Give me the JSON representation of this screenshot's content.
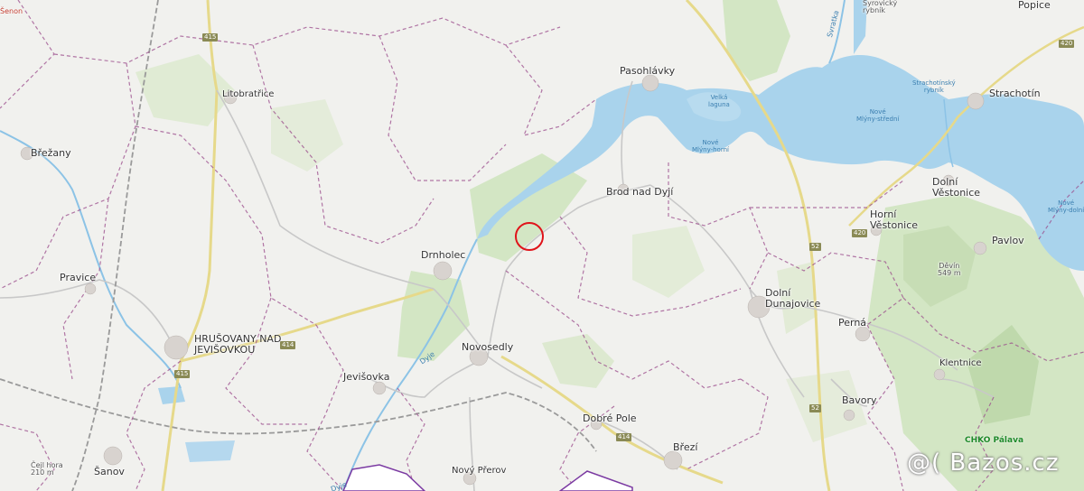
{
  "map": {
    "places": {
      "pasohlavky": "Pasohlávky",
      "strachotin": "Strachotín",
      "popice": "Popice",
      "brod": "Brod nad Dyjí",
      "dolni_vestonice": "Dolní\nVěstonice",
      "horni_vestonice": "Horní\nVěstonice",
      "pavlov": "Pavlov",
      "drnholec": "Drnholec",
      "litobratrice": "Litobratřice",
      "brezany": "Břežany",
      "pravice": "Pravice",
      "hrusovany": "HRUŠOVANY NAD\nJEVIŠOVKOU",
      "jevisovka": "Jevišovka",
      "novosedly": "Novosedly",
      "dolni_dunajovice": "Dolní\nDunajovice",
      "perna": "Perná",
      "klentnice": "Klentnice",
      "bavory": "Bavory",
      "dobre_pole": "Dobré Pole",
      "brezi": "Březí",
      "novy_prerov": "Nový Přerov",
      "sanov": "Šanov",
      "senon": "Šenon",
      "syrovicky": "Syrovický\nrybník"
    },
    "water": {
      "velka_laguna": "Velká\nlaguna",
      "nove_mlyny_horni": "Nové\nMlýny-horní",
      "nove_mlyny_stredni": "Nové\nMlýny-střední",
      "strachotinsky": "Strachotínský\nrybník",
      "nove_mlyny_dolni": "Nové\nMlýny-dolní",
      "svratka": "Svratka",
      "dyje1": "Dyje",
      "dyje2": "Dyje"
    },
    "peaks": {
      "devin": "Děvín\n549 m",
      "cejl": "Čejl hora\n210 m"
    },
    "roads": {
      "r415a": "415",
      "r415b": "415",
      "r414a": "414",
      "r414b": "414",
      "r52a": "52",
      "r52b": "52",
      "r420a": "420",
      "r420b": "420"
    },
    "chko": "CHKO Pálava",
    "watermark": "@( Bazos.cz",
    "colors": {
      "water": "#a9d3ec",
      "forest": "#cfe3c0",
      "border": "#9b4c8c",
      "marker": "#e0131a",
      "road": "#e6d98a",
      "chko": "#1f8a2a"
    }
  }
}
